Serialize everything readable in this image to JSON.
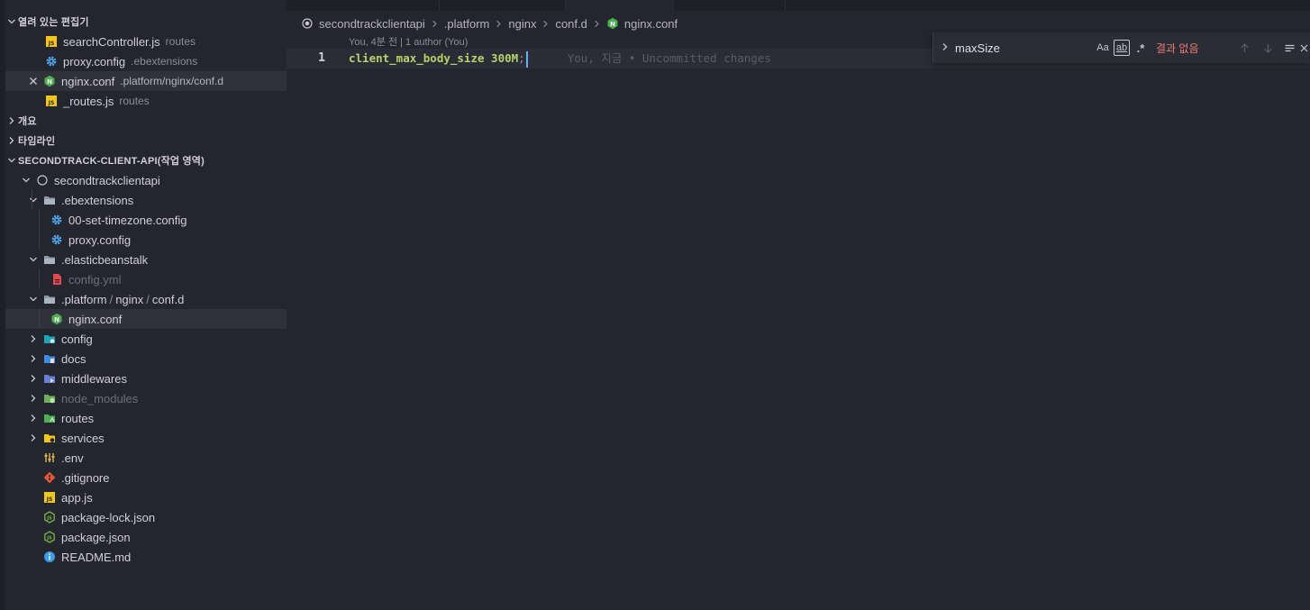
{
  "sidebar": {
    "open_editors": {
      "title": "열려 있는 편집기",
      "items": [
        {
          "name": "searchController.js",
          "desc": "routes"
        },
        {
          "name": "proxy.config",
          "desc": ".ebextensions"
        },
        {
          "name": "nginx.conf",
          "desc": ".platform/nginx/conf.d"
        },
        {
          "name": "_routes.js",
          "desc": "routes"
        }
      ]
    },
    "outline_title": "개요",
    "timeline_title": "타임라인",
    "workspace": {
      "title": "SECONDTRACK-CLIENT-API(작업 영역)",
      "root": "secondtrackclientapi",
      "ebextensions": ".ebextensions",
      "timezone_config": "00-set-timezone.config",
      "proxy_config": "proxy.config",
      "elasticbeanstalk": ".elasticbeanstalk",
      "config_yml": "config.yml",
      "platform_a": ".platform",
      "platform_b": "nginx",
      "platform_c": "conf.d",
      "nginx_conf": "nginx.conf",
      "config": "config",
      "docs": "docs",
      "middlewares": "middlewares",
      "node_modules": "node_modules",
      "routes": "routes",
      "services": "services",
      "env": ".env",
      "gitignore": ".gitignore",
      "app_js": "app.js",
      "package_lock": "package-lock.json",
      "package_json": "package.json",
      "readme": "README.md"
    }
  },
  "breadcrumb": [
    "secondtrackclientapi",
    ".platform",
    "nginx",
    "conf.d",
    "nginx.conf"
  ],
  "editor": {
    "codelens": "You, 4분 전 | 1 author (You)",
    "line_number": "1",
    "code_directive": "client_max_body_size",
    "code_value": "300M",
    "code_semicolon": ";",
    "blame": "You, 지금 • Uncommitted changes"
  },
  "find": {
    "query": "maxSize",
    "match_case": "Aa",
    "whole_word": "ab",
    "regex": ".*",
    "no_result": "결과 없음"
  },
  "colors": {
    "accent": "#5fb4f0",
    "nginx_green": "#4caf50",
    "js_yellow": "#f5c518",
    "error_red": "#f17975"
  }
}
